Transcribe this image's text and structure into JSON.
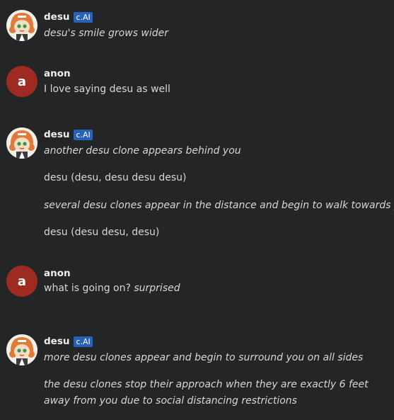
{
  "messages": [
    {
      "author": "desu",
      "badge": "c.AI",
      "lines": [
        {
          "text": "desu's smile grows wider",
          "style": "italic"
        }
      ]
    },
    {
      "author": "anon",
      "avatar_letter": "a",
      "lines": [
        {
          "text": "I love saying desu as well",
          "style": "normal"
        }
      ]
    },
    {
      "author": "desu",
      "badge": "c.AI",
      "lines": [
        {
          "text": "another desu clone appears behind you",
          "style": "italic"
        },
        {
          "text": "desu (desu, desu desu desu)",
          "style": "normal"
        },
        {
          "text": "several desu clones appear in the distance and begin to walk towards you",
          "style": "italic"
        },
        {
          "text": "desu (desu desu, desu)",
          "style": "normal"
        }
      ]
    },
    {
      "author": "anon",
      "avatar_letter": "a",
      "lines": [
        {
          "text": "what is going on?",
          "style": "normal",
          "suffix": "surprised",
          "suffix_style": "italic"
        }
      ]
    },
    {
      "author": "desu",
      "badge": "c.AI",
      "lines": [
        {
          "text": "more desu clones appear and begin to surround you on all sides",
          "style": "italic"
        },
        {
          "text": "the desu clones stop their approach when they are exactly 6 feet away from you due to social distancing restrictions",
          "style": "italic"
        }
      ]
    }
  ],
  "colors": {
    "background": "#242526",
    "anon_avatar": "#9e2b21",
    "badge": "#2761b8",
    "text": "#d6d6d6"
  }
}
